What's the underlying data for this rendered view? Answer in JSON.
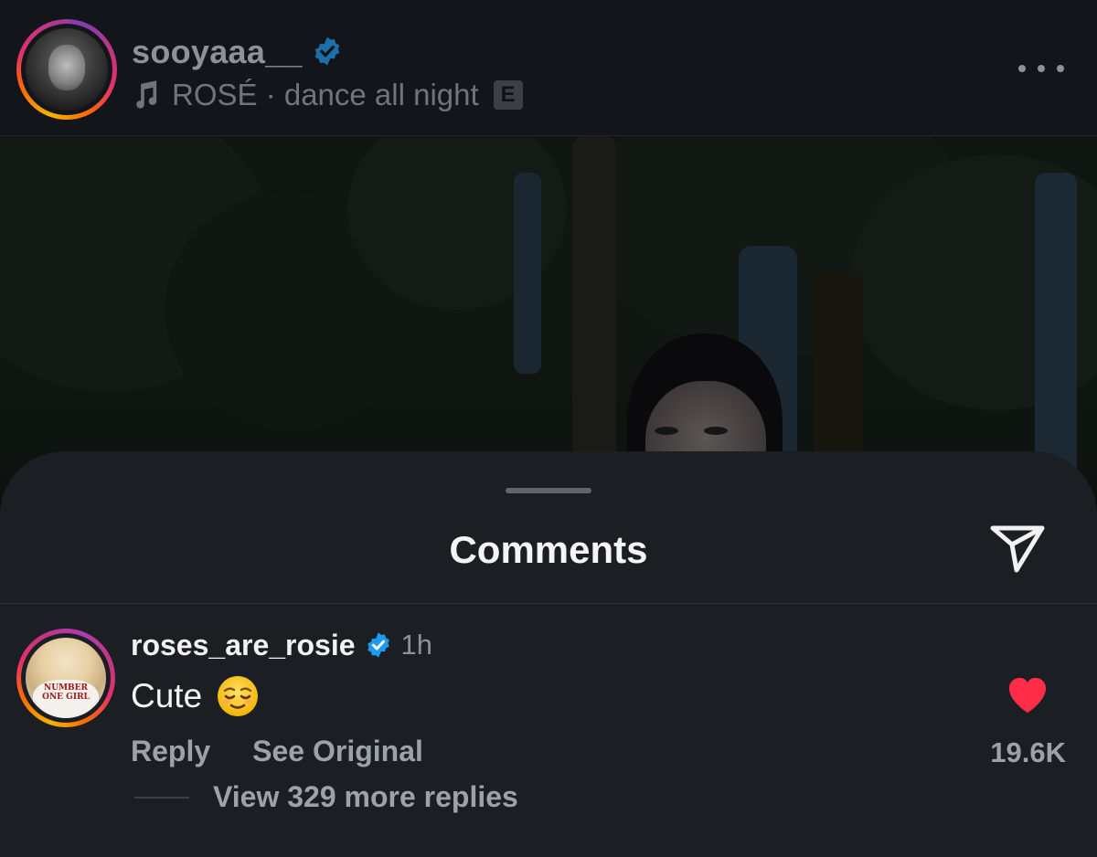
{
  "post": {
    "username": "sooyaaa__",
    "music_track": "ROSÉ · dance all night",
    "explicit_badge": "E"
  },
  "sheet": {
    "title": "Comments"
  },
  "comment": {
    "username": "roses_are_rosie",
    "time": "1h",
    "text": "Cute",
    "emoji": "relieved-face",
    "reply_label": "Reply",
    "see_original_label": "See Original",
    "likes": "19.6K",
    "liked": true,
    "avatar_shirt_text": "NUMBER ONE GIRL",
    "view_replies_label": "View 329 more replies"
  },
  "colors": {
    "verified": "#1d9bf0",
    "heart": "#ff2d48",
    "sheet_bg": "#1b1f23"
  }
}
